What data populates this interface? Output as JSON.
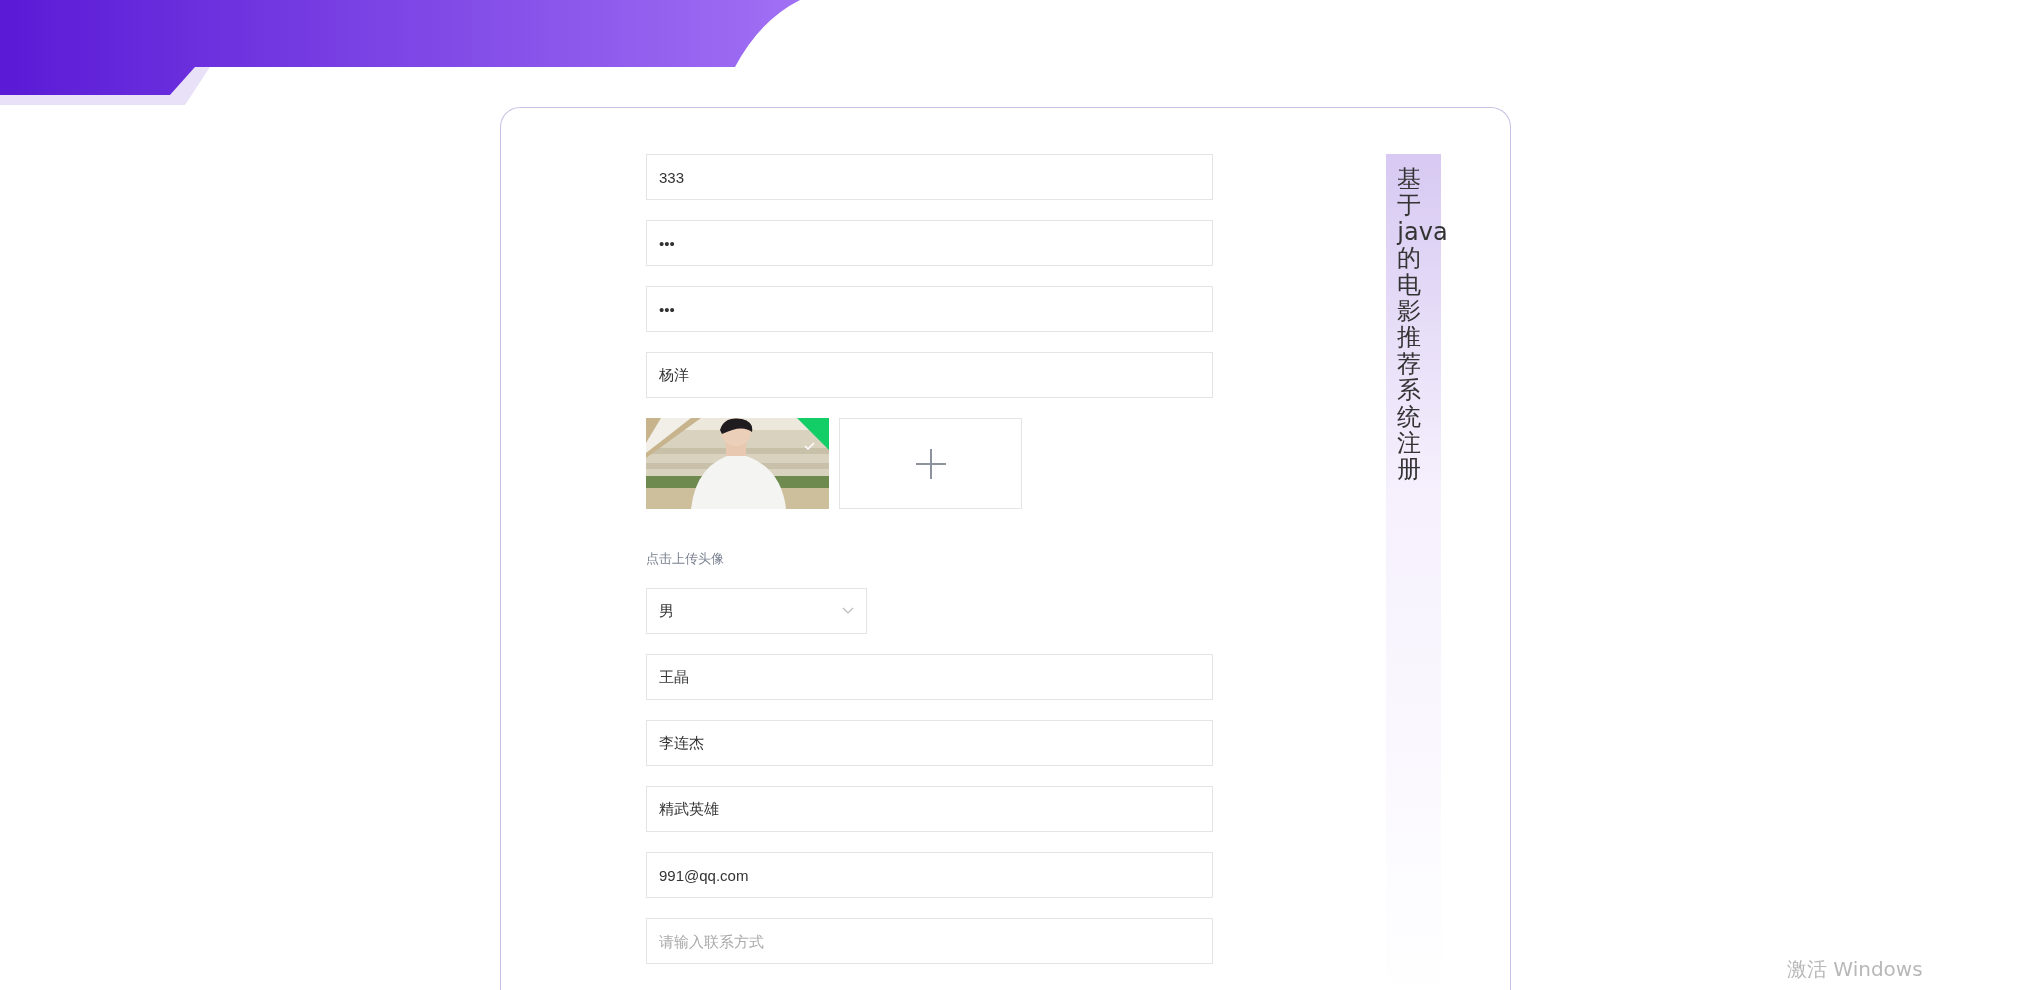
{
  "form": {
    "rows": [
      {
        "kind": "text",
        "value": "333"
      },
      {
        "kind": "password",
        "value": "•••"
      },
      {
        "kind": "password",
        "value": "•••"
      },
      {
        "kind": "text",
        "value": "杨洋"
      },
      {
        "kind": "upload",
        "files": [
          {
            "kind": "picture",
            "uploaded": true
          }
        ],
        "hint": "点击上传头像"
      },
      {
        "kind": "select",
        "value": "男"
      },
      {
        "kind": "text",
        "value": "王晶"
      },
      {
        "kind": "text",
        "value": "李连杰"
      },
      {
        "kind": "text",
        "value": "精武英雄"
      },
      {
        "kind": "text",
        "value": "991@qq.com"
      },
      {
        "kind": "text",
        "placeholder": "请输入联系方式"
      }
    ]
  },
  "title": "基于java的电影推荐系统注册",
  "watermark": "激活 Windows"
}
